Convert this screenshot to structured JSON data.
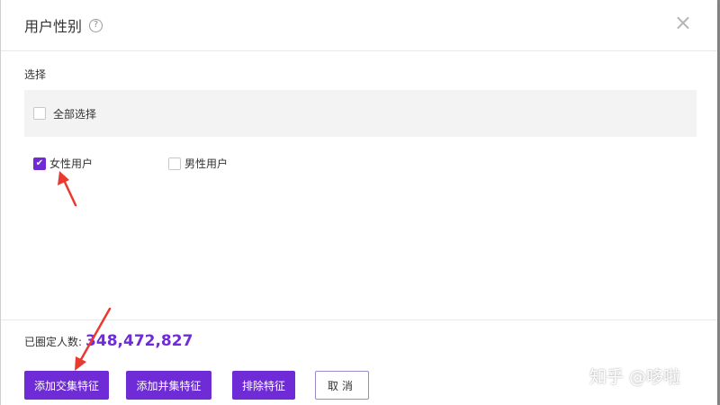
{
  "dialog": {
    "title": "用户性别",
    "help_icon": "question-circle-icon",
    "close_icon": "close-icon",
    "close_glyph": "×"
  },
  "select_section": {
    "label": "选择",
    "select_all": {
      "label": "全部选择",
      "checked": false
    },
    "options": [
      {
        "label": "女性用户",
        "checked": true
      },
      {
        "label": "男性用户",
        "checked": false
      }
    ]
  },
  "footer": {
    "count_label": "已圈定人数:",
    "count_value": "348,472,827",
    "buttons": {
      "intersect": "添加交集特征",
      "union": "添加并集特征",
      "exclude": "排除特征",
      "cancel": "取消"
    }
  },
  "watermark": "知乎 @哆啦",
  "colors": {
    "accent": "#6f2bd6",
    "annotation_arrow": "#e83a30"
  }
}
